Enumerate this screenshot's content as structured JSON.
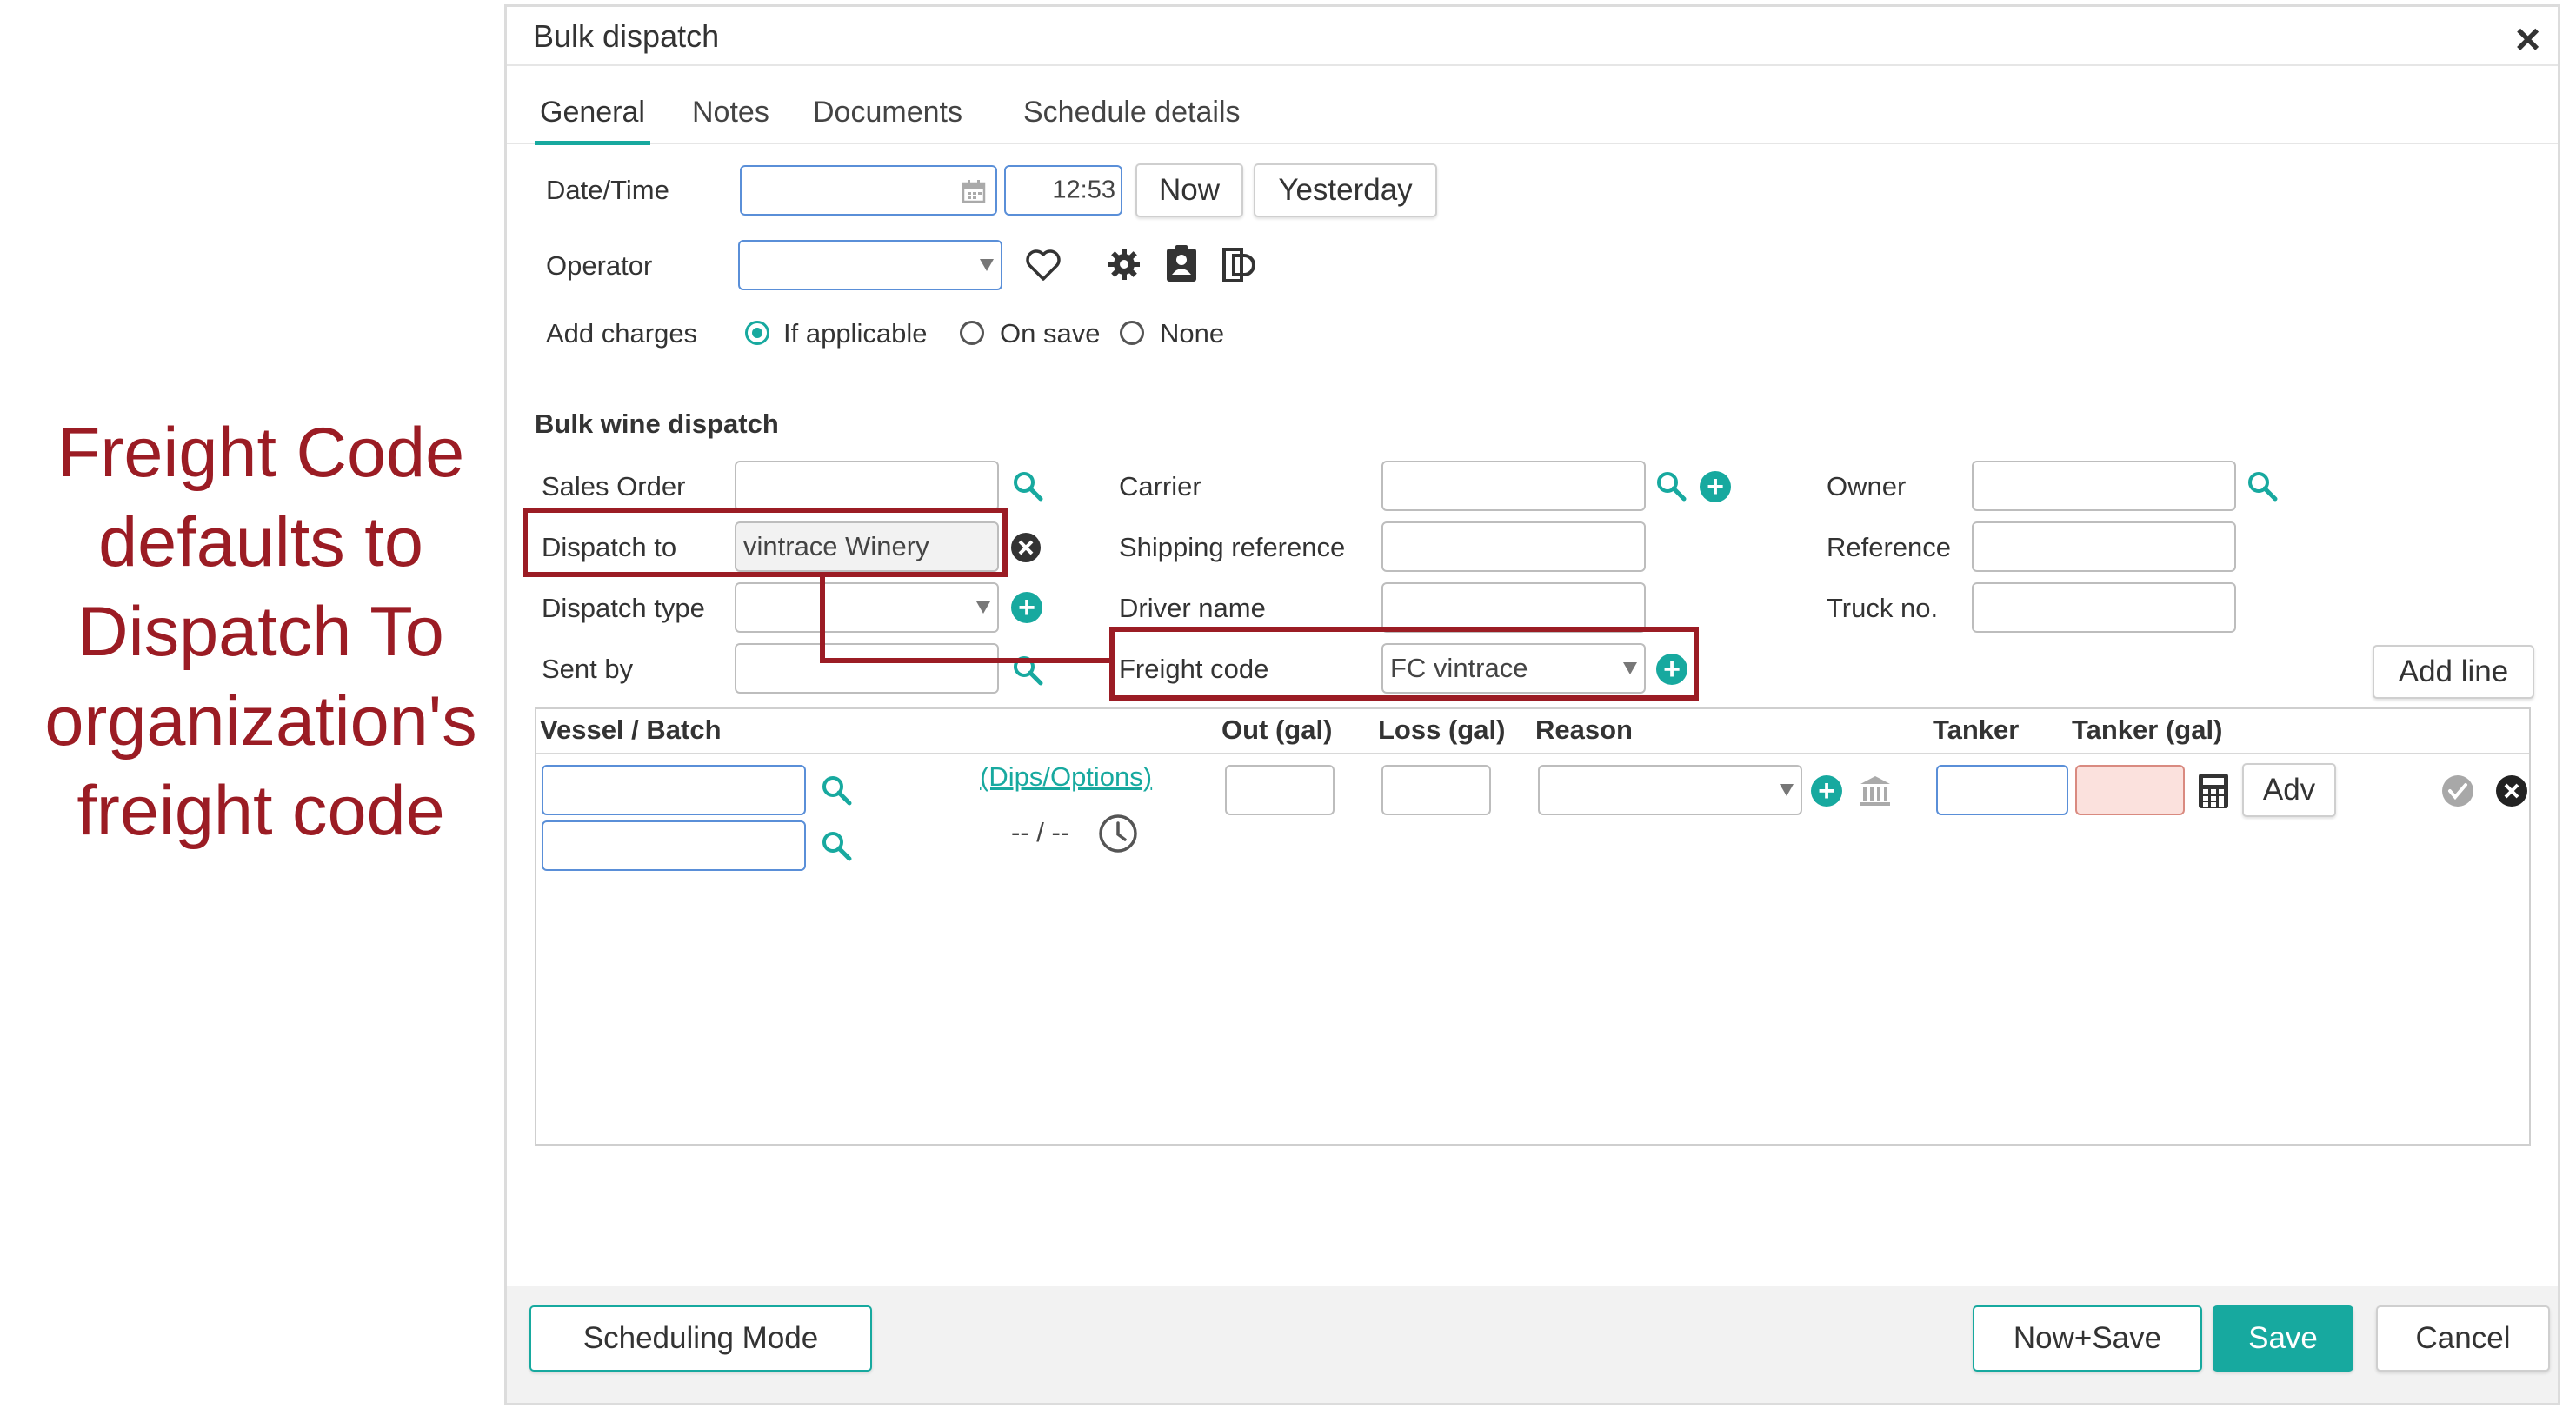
{
  "annotation": {
    "lines": [
      "Freight Code",
      "defaults to",
      "Dispatch To",
      "organization's",
      "freight code"
    ]
  },
  "dialog": {
    "title": "Bulk dispatch",
    "close_glyph": "×",
    "tabs": [
      {
        "label": "General",
        "active": true
      },
      {
        "label": "Notes"
      },
      {
        "label": "Documents"
      },
      {
        "label": "Schedule details"
      }
    ]
  },
  "general": {
    "datetime_label": "Date/Time",
    "time_value": "12:53",
    "now_button": "Now",
    "yesterday_button": "Yesterday",
    "operator_label": "Operator",
    "add_charges_label": "Add charges",
    "charges_options": [
      "If applicable",
      "On save",
      "None"
    ],
    "charges_selected": "If applicable"
  },
  "bulk": {
    "section_title": "Bulk wine dispatch",
    "sales_order_label": "Sales Order",
    "dispatch_to_label": "Dispatch to",
    "dispatch_to_value": "vintrace Winery",
    "dispatch_type_label": "Dispatch type",
    "sent_by_label": "Sent by",
    "carrier_label": "Carrier",
    "shipping_reference_label": "Shipping reference",
    "driver_name_label": "Driver name",
    "freight_code_label": "Freight code",
    "freight_code_value": "FC vintrace",
    "owner_label": "Owner",
    "reference_label": "Reference",
    "truck_no_label": "Truck no.",
    "add_line_button": "Add line"
  },
  "lines_table": {
    "headers": [
      "Vessel / Batch",
      "Out (gal)",
      "Loss (gal)",
      "Reason",
      "Tanker",
      "Tanker (gal)"
    ],
    "dips_link": "(Dips/Options)",
    "time_placeholder": "-- / --",
    "adv_button": "Adv"
  },
  "footer": {
    "scheduling_button": "Scheduling Mode",
    "now_save_button": "Now+Save",
    "save_button": "Save",
    "cancel_button": "Cancel"
  },
  "colors": {
    "accent": "#17a99f",
    "annotation": "#9b1c24",
    "input_focus_border": "#5a8fd8",
    "tanker_invalid": "#fbe1dd"
  },
  "icons": {
    "calendar": "calendar-icon",
    "favorite": "heart-icon",
    "settings": "gear-icon",
    "contact": "contact-card-icon",
    "document": "document-icon",
    "search": "search-icon",
    "add": "plus-circle-icon",
    "clear": "x-circle-icon",
    "bank": "bank-icon",
    "calculator": "calculator-icon",
    "clock": "clock-icon",
    "confirm": "check-circle-icon"
  }
}
